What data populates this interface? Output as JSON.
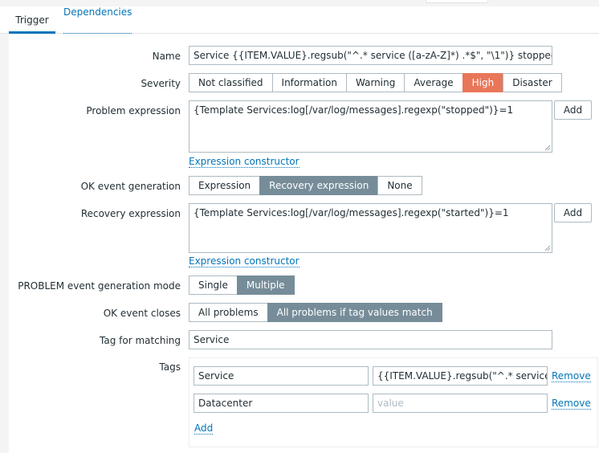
{
  "tabs": {
    "trigger": "Trigger",
    "dependencies": "Dependencies"
  },
  "form": {
    "name": {
      "label": "Name",
      "value": "Service {{ITEM.VALUE}.regsub(\"^.* service ([a-zA-Z]*) .*$\", \"\\1\")} stopped"
    },
    "severity": {
      "label": "Severity",
      "options": [
        "Not classified",
        "Information",
        "Warning",
        "Average",
        "High",
        "Disaster"
      ],
      "selected": "High"
    },
    "problem_expression": {
      "label": "Problem expression",
      "value": "{Template Services:log[/var/log/messages].regexp(\"stopped\")}=1",
      "add_label": "Add",
      "constructor_label": "Expression constructor"
    },
    "ok_event_generation": {
      "label": "OK event generation",
      "options": [
        "Expression",
        "Recovery expression",
        "None"
      ],
      "selected": "Recovery expression"
    },
    "recovery_expression": {
      "label": "Recovery expression",
      "value": "{Template Services:log[/var/log/messages].regexp(\"started\")}=1",
      "add_label": "Add",
      "constructor_label": "Expression constructor"
    },
    "problem_mode": {
      "label": "PROBLEM event generation mode",
      "options": [
        "Single",
        "Multiple"
      ],
      "selected": "Multiple"
    },
    "ok_event_closes": {
      "label": "OK event closes",
      "options": [
        "All problems",
        "All problems if tag values match"
      ],
      "selected": "All problems if tag values match"
    },
    "tag_for_matching": {
      "label": "Tag for matching",
      "value": "Service"
    },
    "tags": {
      "label": "Tags",
      "rows": [
        {
          "tag": "Service",
          "value": "{{ITEM.VALUE}.regsub(\"^.* service ([a-",
          "value_placeholder": "value",
          "remove_label": "Remove"
        },
        {
          "tag": "Datacenter",
          "value": "",
          "value_placeholder": "value",
          "remove_label": "Remove"
        }
      ],
      "add_label": "Add"
    }
  },
  "colors": {
    "accent": "#0275b8",
    "high": "#e97659",
    "selected": "#768d99"
  }
}
